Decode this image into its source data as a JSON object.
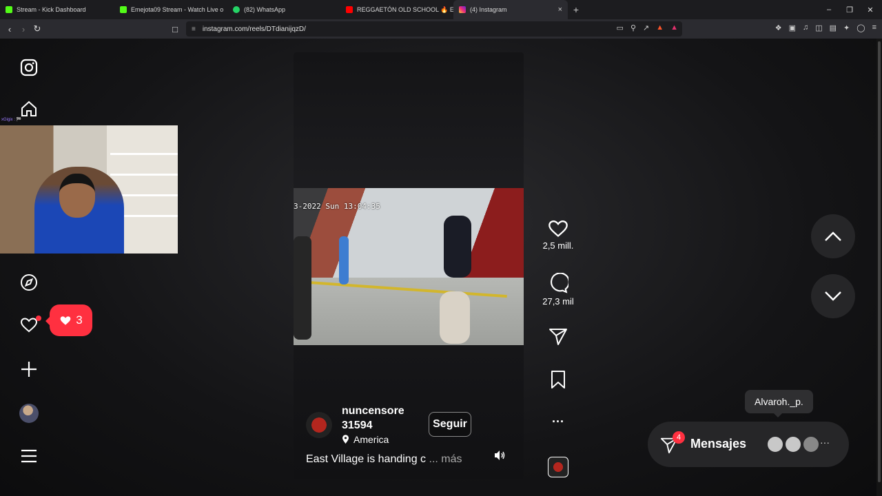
{
  "tabs": [
    {
      "title": "Stream - Kick Dashboard",
      "color": "#53fc18"
    },
    {
      "title": "Emejota09 Stream - Watch Live o",
      "color": "#53fc18"
    },
    {
      "title": "(82) WhatsApp",
      "color": "#25d366"
    },
    {
      "title": "REGGAETÓN OLD SCHOOL 🔥 ENG",
      "color": "#ff0000"
    },
    {
      "title": "(4) Instagram",
      "color": "#e1306c"
    }
  ],
  "browser": {
    "url": "instagram.com/reels/DTdianijqzD/",
    "new_tab": "+",
    "close_tab": "×"
  },
  "sidebar": {
    "likes_count": "3"
  },
  "webcam": {
    "chat_text": "xGigix : 🏁"
  },
  "reel": {
    "timestamp": "3-2022 Sun 13:04:35",
    "author_line1": "nuncensore",
    "author_line2": "31594",
    "location": "America",
    "follow_label": "Seguir",
    "caption": "East Village is handing c",
    "caption_more": "... más"
  },
  "actions": {
    "likes": "2,5 mill.",
    "comments": "27,3 mil",
    "more": "···"
  },
  "messages": {
    "tooltip": "Alvaroh._p.",
    "label": "Mensajes",
    "badge": "4",
    "more": "···"
  },
  "colors": {
    "accent_red": "#ff3040",
    "panel": "#262628"
  }
}
